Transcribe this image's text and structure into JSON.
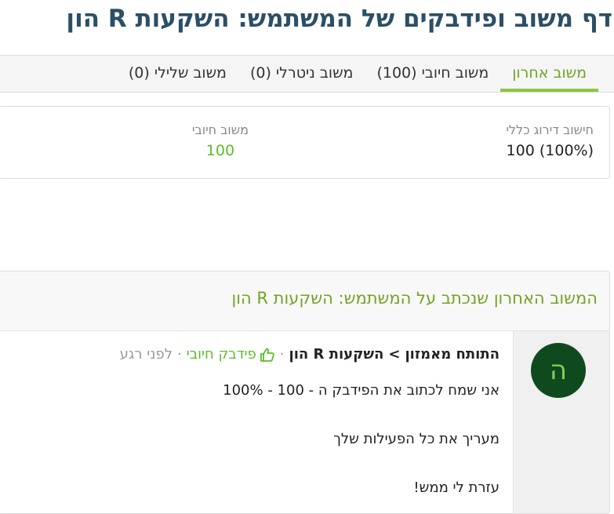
{
  "page": {
    "title": "דף משוב ופידבקים של המשתמש: השקעות R הון"
  },
  "tabs": [
    {
      "label": "משוב אחרון"
    },
    {
      "label": "משוב חיובי (100)"
    },
    {
      "label": "משוב ניטרלי (0)"
    },
    {
      "label": "משוב שלילי (0)"
    }
  ],
  "stats": {
    "overall_label": "חישוב דירוג כללי",
    "overall_value": "100 (100%)",
    "positive_label": "משוב חיובי",
    "positive_value": "100"
  },
  "latest": {
    "title": "המשוב האחרון שנכתב על המשתמש: השקעות R הון",
    "avatar_letter": "ה",
    "reviewer": "התותח מאמזון",
    "separator": ">",
    "target": "השקעות R הון",
    "dot": "·",
    "feedback_type": "פידבק חיובי",
    "time": "לפני רגע",
    "text": "אני שמח לכתוב את הפידבק ה - 100 - 100%\n\nמעריך את כל הפעילות שלך\n\nעזרת לי ממש!"
  },
  "colors": {
    "title": "#2b4f66",
    "accent_green": "#73a322",
    "positive_green": "#5bbd2b",
    "avatar_bg": "#0e4a1e"
  },
  "icons": {
    "feedback_type_icon": "thumbs-up-icon"
  }
}
